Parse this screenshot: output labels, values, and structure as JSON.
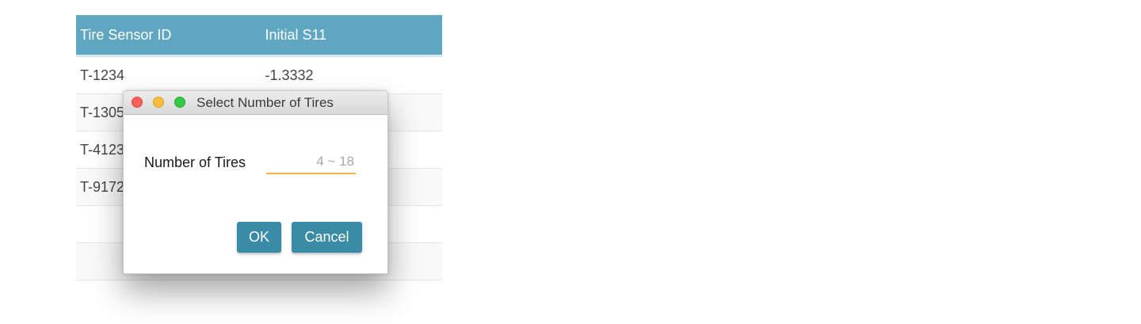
{
  "table": {
    "columns": [
      "Tire Sensor ID",
      "Initial S11"
    ],
    "rows": [
      [
        "T-1234",
        "-1.3332"
      ],
      [
        "T-1305",
        ""
      ],
      [
        "T-4123",
        ""
      ],
      [
        "T-9172",
        ""
      ],
      [
        "",
        ""
      ],
      [
        "",
        ""
      ]
    ]
  },
  "dialog": {
    "title": "Select Number of Tires",
    "field_label": "Number of Tires",
    "field_value": "",
    "field_placeholder": "4 ~ 18",
    "ok_label": "OK",
    "cancel_label": "Cancel"
  },
  "colors": {
    "header_bg": "#5fa6c0",
    "button_bg": "#3a8ba6",
    "input_underline": "#f5b84b"
  }
}
